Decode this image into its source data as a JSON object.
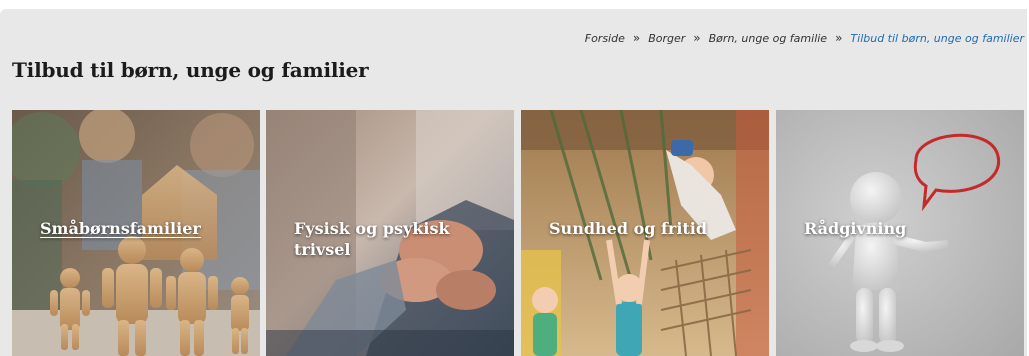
{
  "breadcrumb": {
    "items": [
      "Forside",
      "Borger",
      "Børn, unge og familie"
    ],
    "current": "Tilbud til børn, unge og familier",
    "separator": "»"
  },
  "page": {
    "title": "Tilbud til børn, unge og familier"
  },
  "cards": [
    {
      "title": "Småbørnsfamilier",
      "underlined": true
    },
    {
      "title": "Fysisk og psykisk trivsel"
    },
    {
      "title": "Sundhed og fritid"
    },
    {
      "title": "Rådgivning"
    }
  ],
  "colors": {
    "panel_background": "#e8e8e8",
    "link_current": "#1f6bb0",
    "text": "#1b1b1b",
    "card_title": "#ffffff"
  }
}
